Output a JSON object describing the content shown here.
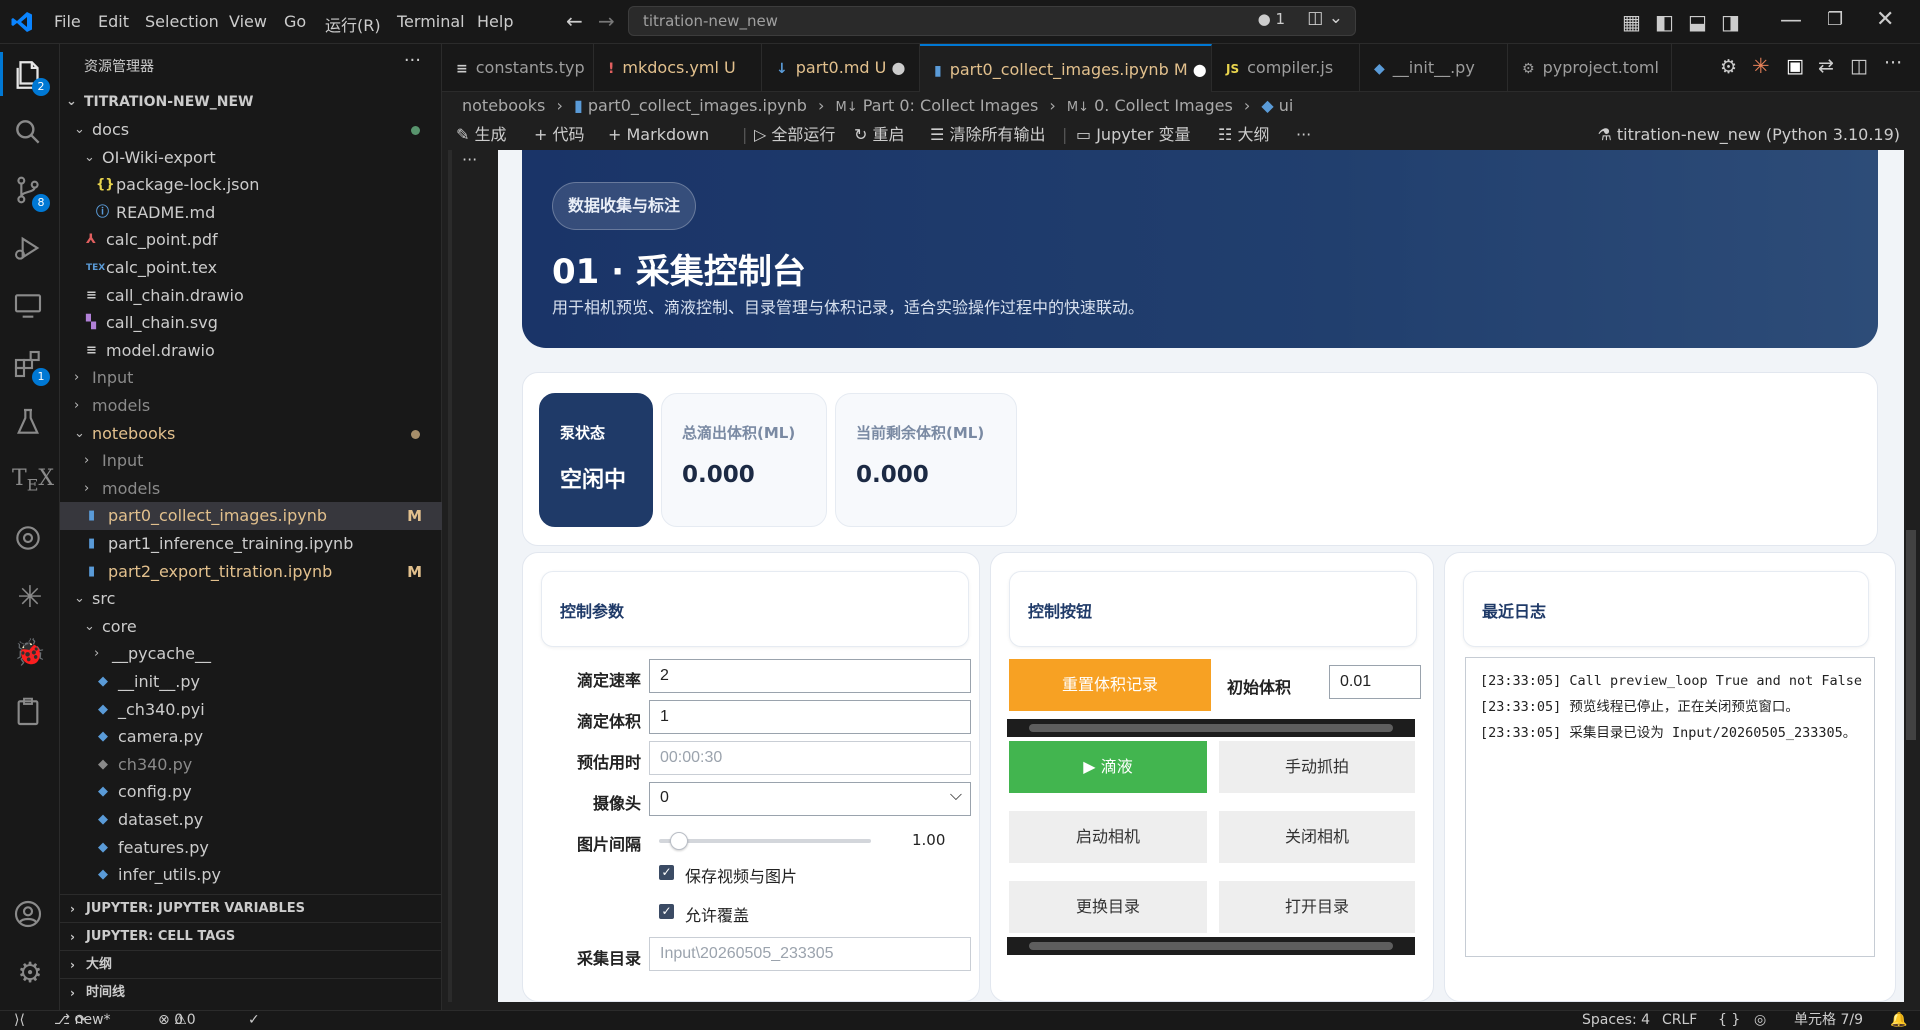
{
  "titlebar": {
    "menu": [
      "File",
      "Edit",
      "Selection",
      "View",
      "Go",
      "运行(R)",
      "Terminal",
      "Help"
    ],
    "search": "titration-new_new",
    "counter": "1"
  },
  "activity": {
    "source_control_badge": "8",
    "extensions_badge": "1",
    "explorer_badge": "2"
  },
  "sidebar": {
    "title": "资源管理器",
    "root": "TITRATION-NEW_NEW",
    "items": [
      {
        "label": "docs"
      },
      {
        "label": "OI-Wiki-export"
      },
      {
        "label": "package-lock.json"
      },
      {
        "label": "README.md"
      },
      {
        "label": "calc_point.pdf"
      },
      {
        "label": "calc_point.tex"
      },
      {
        "label": "call_chain.drawio"
      },
      {
        "label": "call_chain.svg"
      },
      {
        "label": "model.drawio"
      },
      {
        "label": "Input"
      },
      {
        "label": "models"
      },
      {
        "label": "notebooks"
      },
      {
        "label": "Input"
      },
      {
        "label": "models"
      },
      {
        "label": "part0_collect_images.ipynb",
        "mod": "M"
      },
      {
        "label": "part1_inference_training.ipynb"
      },
      {
        "label": "part2_export_titration.ipynb",
        "mod": "M"
      },
      {
        "label": "src"
      },
      {
        "label": "core"
      },
      {
        "label": "__pycache__"
      },
      {
        "label": "__init__.py"
      },
      {
        "label": "_ch340.pyi"
      },
      {
        "label": "camera.py"
      },
      {
        "label": "ch340.py"
      },
      {
        "label": "config.py"
      },
      {
        "label": "dataset.py"
      },
      {
        "label": "features.py"
      },
      {
        "label": "infer_utils.py"
      }
    ],
    "sections": [
      "JUPYTER: JUPYTER VARIABLES",
      "JUPYTER: CELL TAGS",
      "大纲",
      "时间线"
    ]
  },
  "tabs": [
    {
      "label": "constants.typ"
    },
    {
      "label": "mkdocs.yml",
      "suffix": "U"
    },
    {
      "label": "part0.md",
      "suffix": "U"
    },
    {
      "label": "part0_collect_images.ipynb",
      "suffix": "M"
    },
    {
      "label": "compiler.js"
    },
    {
      "label": "__init__.py"
    },
    {
      "label": "pyproject.toml"
    }
  ],
  "breadcrumb": [
    "notebooks",
    "part0_collect_images.ipynb",
    "Part 0: Collect Images",
    "0. Collect Images",
    "ui"
  ],
  "toolbar": {
    "generate": "生成",
    "code": "代码",
    "markdown": "Markdown",
    "run_all": "全部运行",
    "restart": "重启",
    "clear": "清除所有输出",
    "variables": "Jupyter 变量",
    "outline": "大纲",
    "kernel": "titration-new_new (Python 3.10.19)"
  },
  "hero": {
    "pill": "数据收集与标注",
    "title": "01 · 采集控制台",
    "subtitle": "用于相机预览、滴液控制、目录管理与体积记录，适合实验操作过程中的快速联动。"
  },
  "stats": [
    {
      "label": "泵状态",
      "value": "空闲中"
    },
    {
      "label": "总滴出体积(ML)",
      "value": "0.000"
    },
    {
      "label": "当前剩余体积(ML)",
      "value": "0.000"
    }
  ],
  "params": {
    "title": "控制参数",
    "rate_label": "滴定速率",
    "rate": "2",
    "volume_label": "滴定体积",
    "volume": "1",
    "eta_label": "预估用时",
    "eta": "00:00:30",
    "camera_label": "摄像头",
    "camera": "0",
    "interval_label": "图片间隔",
    "interval": "1.00",
    "interval_fraction": 0.05,
    "save_label": "保存视频与图片",
    "overwrite_label": "允许覆盖",
    "dir_label": "采集目录",
    "dir": "Input\\20260505_233305"
  },
  "controls": {
    "title": "控制按钮",
    "reset": "重置体积记录",
    "init_label": "初始体积",
    "init_value": "0.01",
    "drip": "▶ 滴液",
    "capture": "手动抓拍",
    "start_cam": "启动相机",
    "stop_cam": "关闭相机",
    "change_dir": "更换目录",
    "open_dir": "打开目录"
  },
  "log": {
    "title": "最近日志",
    "lines": [
      "[23:33:05] Call preview_loop True and not False",
      "[23:33:05] 预览线程已停止，正在关闭预览窗口。",
      "[23:33:05] 采集目录已设为 Input/20260505_233305。"
    ]
  },
  "statusbar": {
    "branch": "new*",
    "errors": "0",
    "warnings": "0",
    "spaces": "Spaces: 4",
    "eol": "CRLF",
    "cell": "单元格 7/9"
  },
  "colors": {
    "accent": "#0078d4",
    "orange": "#f7a123",
    "green": "#42b54f",
    "navy": "#1f3a68"
  }
}
